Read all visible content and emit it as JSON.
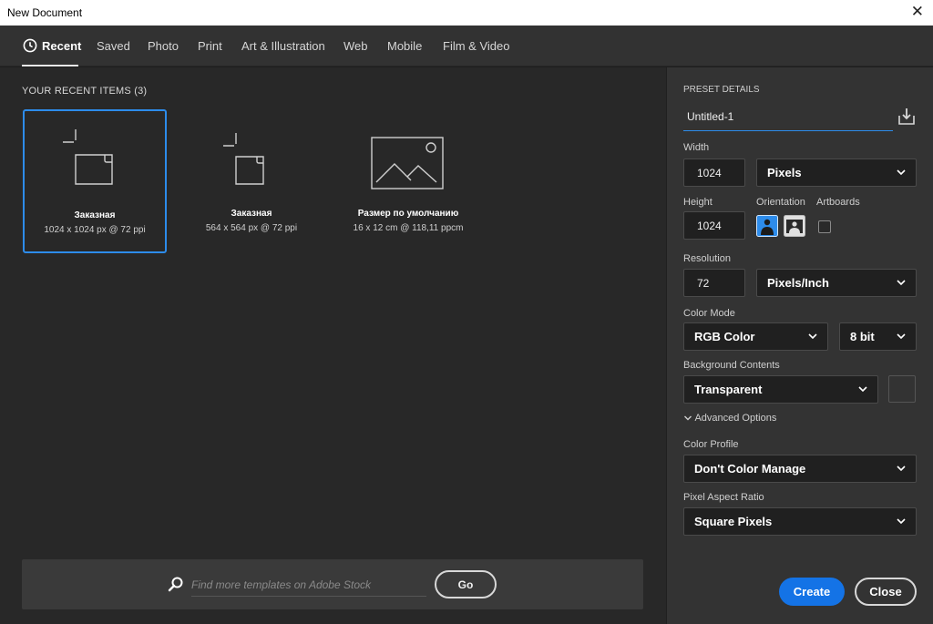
{
  "window": {
    "title": "New Document",
    "close_glyph": "✕"
  },
  "tabs": [
    {
      "label": "Recent",
      "active": true
    },
    {
      "label": "Saved"
    },
    {
      "label": "Photo"
    },
    {
      "label": "Print"
    },
    {
      "label": "Art & Illustration"
    },
    {
      "label": "Web"
    },
    {
      "label": "Mobile"
    },
    {
      "label": "Film & Video"
    }
  ],
  "recent": {
    "title": "YOUR RECENT ITEMS",
    "count": "(3)",
    "items": [
      {
        "name": "Заказная",
        "size": "1024 x 1024 px @ 72 ppi",
        "icon": "new-doc-icon",
        "selected": true
      },
      {
        "name": "Заказная",
        "size": "564 x 564 px @ 72 ppi",
        "icon": "new-doc-icon"
      },
      {
        "name": "Размер по умолчанию",
        "size": "16 x 12 cm @ 118,11 ppcm",
        "icon": "image-placeholder-icon"
      }
    ]
  },
  "search": {
    "placeholder": "Find more templates on Adobe Stock",
    "go_label": "Go"
  },
  "preset": {
    "header": "PRESET DETAILS",
    "name": "Untitled-1",
    "width_label": "Width",
    "width_value": "1024",
    "width_unit": "Pixels",
    "height_label": "Height",
    "height_value": "1024",
    "orientation_label": "Orientation",
    "artboards_label": "Artboards",
    "resolution_label": "Resolution",
    "resolution_value": "72",
    "resolution_unit": "Pixels/Inch",
    "color_mode_label": "Color Mode",
    "color_mode": "RGB Color",
    "bit_depth": "8 bit",
    "background_label": "Background Contents",
    "background": "Transparent",
    "advanced_label": "Advanced Options",
    "color_profile_label": "Color Profile",
    "color_profile": "Don't Color Manage",
    "pixel_aspect_label": "Pixel Aspect Ratio",
    "pixel_aspect": "Square Pixels"
  },
  "buttons": {
    "create": "Create",
    "close": "Close"
  },
  "colors": {
    "accent": "#1473e6",
    "selection": "#2d8ceb"
  }
}
